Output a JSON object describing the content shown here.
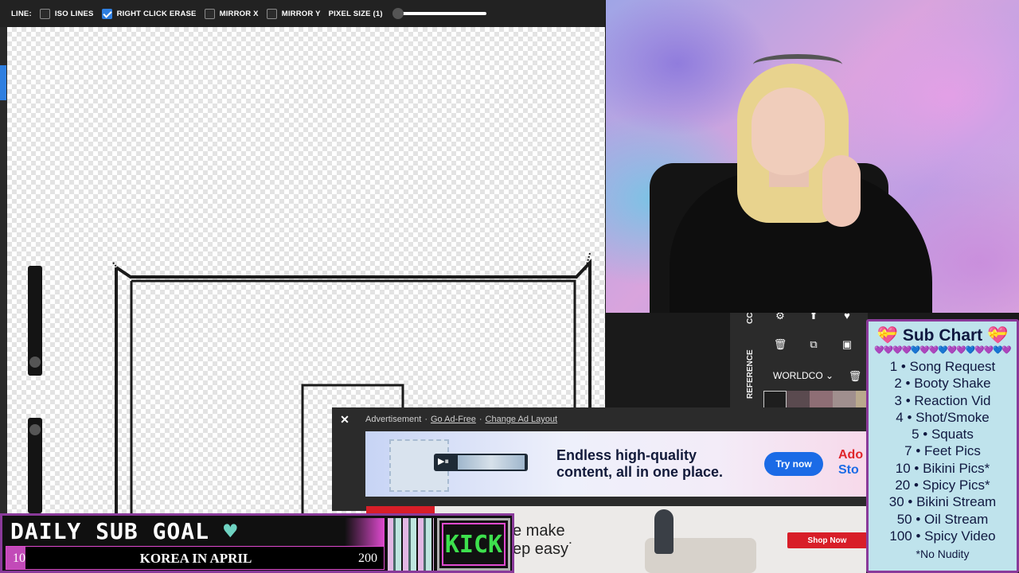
{
  "toolbar": {
    "line_label": "LINE:",
    "options": [
      {
        "label": "ISO LINES",
        "checked": false
      },
      {
        "label": "RIGHT CLICK ERASE",
        "checked": true
      },
      {
        "label": "MIRROR X",
        "checked": false
      },
      {
        "label": "MIRROR Y",
        "checked": false
      }
    ],
    "pixel_size_label": "PIXEL SIZE (1)",
    "pixel_size_level": 0.0
  },
  "side_panel": {
    "cc_label": "CC",
    "reference_label": "REFERENCE",
    "palette_name": "WORLDCO",
    "icons": [
      "gear-icon",
      "arrow-up-icon",
      "heart-icon",
      "trash-icon",
      "copy-icon",
      "image-icon",
      "trash-icon"
    ],
    "swatches": [
      "#1e1e1e",
      "#5a4a4f",
      "#8e6e75",
      "#a08f8e",
      "#b9a98d",
      "#d6c49a"
    ]
  },
  "ad": {
    "close_symbol": "✕",
    "label": "Advertisement",
    "sep": "·",
    "go_ad_free": "Go Ad-Free",
    "change_layout": "Change Ad Layout",
    "headline_line1": "Endless high-quality",
    "headline_line2": "content, all in one place.",
    "cta": "Try now",
    "brand_line1": "Ado",
    "brand_line2": "Sto"
  },
  "ad2": {
    "line1": "e make",
    "line2": "ep easy˙",
    "cta": "Shop Now"
  },
  "sub_chart": {
    "title": "Sub Chart",
    "heart_icon": "💝",
    "hearts_row": "💜💜💜💜💙💜💜💙💜💜💙💜💜💙💜",
    "items": [
      "1 • Song Request",
      "2 • Booty Shake",
      "3 • Reaction Vid",
      "4 • Shot/Smoke",
      "5 • Squats",
      "7 • Feet Pics",
      "10 • Bikini Pics*",
      "20 • Spicy Pics*",
      "30 • Bikini Stream",
      "50 • Oil Stream",
      "100 • Spicy Video"
    ],
    "note": "*No Nudity"
  },
  "sub_goal": {
    "title": "DAILY SUB GOAL",
    "heart": "♥",
    "current": "10",
    "label": "KOREA IN APRIL",
    "max": "200",
    "progress": 0.05,
    "platform": "KICK"
  },
  "colors": {
    "accent_blue": "#2f7fe0",
    "goal_border": "#8a3a9a",
    "goal_pink": "#e04ad0",
    "kick_green": "#3de04d",
    "sub_chart_bg": "#bfe3ec"
  }
}
